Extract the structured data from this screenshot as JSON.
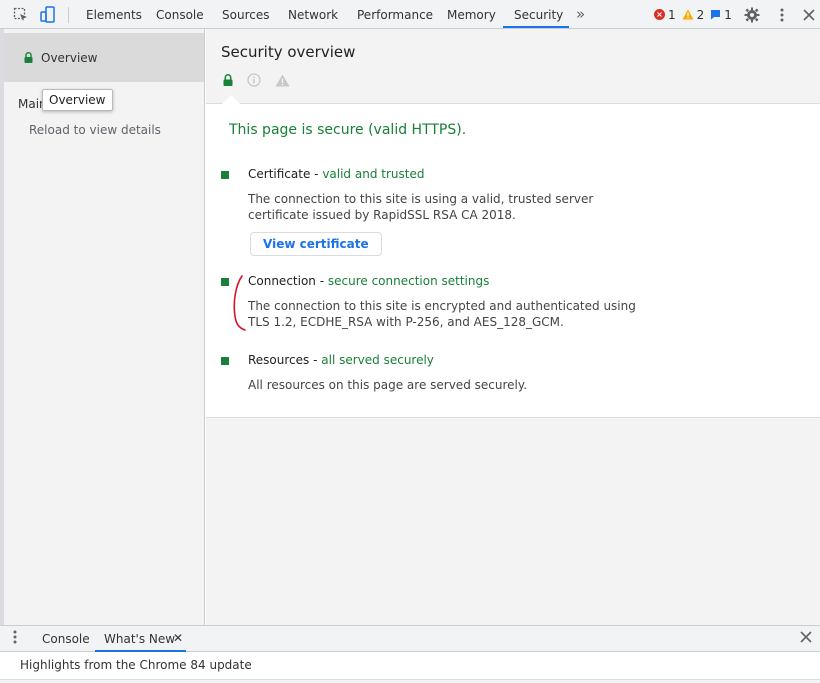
{
  "colors": {
    "accent": "#1a73e8",
    "secure_green": "#188038",
    "error_red": "#d93025",
    "warning_yellow": "#f9ab00",
    "annotation_red": "#d5152a"
  },
  "toolbar": {
    "icons": [
      "inspect-element-icon",
      "device-toolbar-icon",
      "more-tabs-icon",
      "settings-gear-icon",
      "more-options-icon",
      "close-icon"
    ],
    "tabs": [
      {
        "label": "Elements"
      },
      {
        "label": "Console"
      },
      {
        "label": "Sources"
      },
      {
        "label": "Network"
      },
      {
        "label": "Performance"
      },
      {
        "label": "Memory"
      },
      {
        "label": "Security",
        "active": true
      }
    ],
    "more_tabs_glyph": "»",
    "errors_count": "1",
    "warnings_count": "2",
    "messages_count": "1"
  },
  "sidebar": {
    "overview_label": "Overview",
    "main_origin_label": "Main",
    "reload_label": "Reload to view details",
    "tooltip": "Overview"
  },
  "main": {
    "title": "Security overview",
    "secure_summary": "This page is secure (valid HTTPS).",
    "sections": [
      {
        "name": "Certificate",
        "sep": " - ",
        "status": "valid and trusted",
        "body": "The connection to this site is using a valid, trusted server certificate issued by RapidSSL RSA CA 2018.",
        "button": "View certificate"
      },
      {
        "name": "Connection",
        "sep": " - ",
        "status": "secure connection settings",
        "body_before": "The connection to this site is encrypted and authenticated ",
        "body_highlight": "using TLS 1.2",
        "body_after": ", ECDHE_RSA with P-256, and AES_128_GCM."
      },
      {
        "name": "Resources",
        "sep": " - ",
        "status": "all served securely",
        "body": "All resources on this page are served securely."
      }
    ]
  },
  "drawer": {
    "tabs": [
      {
        "label": "Console"
      },
      {
        "label": "What's New",
        "active": true
      }
    ],
    "tab_close_glyph": "✕",
    "content": "Highlights from the Chrome 84 update"
  }
}
